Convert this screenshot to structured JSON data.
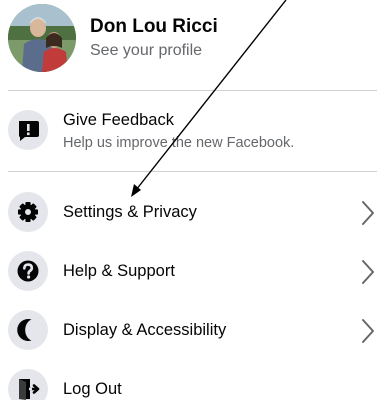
{
  "profile": {
    "name": "Don Lou Ricci",
    "subtitle": "See your profile"
  },
  "feedback": {
    "label": "Give Feedback",
    "subtitle": "Help us improve the new Facebook."
  },
  "menu": {
    "settings": "Settings & Privacy",
    "help": "Help & Support",
    "display": "Display & Accessibility",
    "logout": "Log Out"
  },
  "icons": {
    "feedback": "exclamation-icon",
    "settings": "gear-icon",
    "help": "question-icon",
    "display": "moon-icon",
    "logout": "log-out-icon",
    "chevron": "chevron-right-icon"
  },
  "colors": {
    "icon_bg": "#e4e6eb",
    "icon_fg": "#050505",
    "secondary_text": "#65676b",
    "annotation_arrow": "#000000"
  }
}
